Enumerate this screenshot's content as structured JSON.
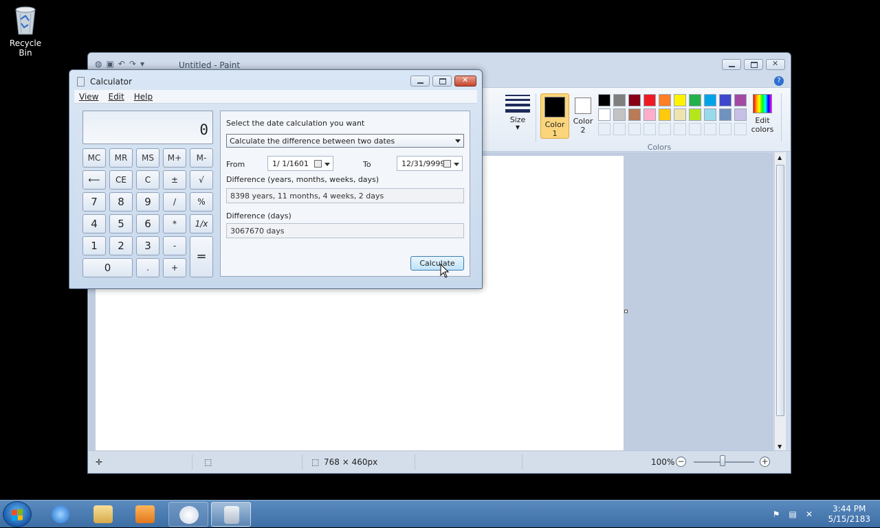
{
  "desktop": {
    "recycle_bin_label": "Recycle Bin"
  },
  "paint": {
    "title": "Untitled - Paint",
    "ribbon": {
      "size_label": "Size",
      "color1_label": "Color 1",
      "color2_label": "Color 2",
      "edit_colors_label": "Edit colors",
      "colors_group_label": "Colors",
      "color1_value": "#000000",
      "color2_value": "#ffffff",
      "palette_row1": [
        "#000000",
        "#7f7f7f",
        "#880015",
        "#ed1c24",
        "#ff7f27",
        "#fff200",
        "#22b14c",
        "#00a2e8",
        "#3f48cc",
        "#a349a4"
      ],
      "palette_row2": [
        "#ffffff",
        "#c3c3c3",
        "#b97a57",
        "#ffaec9",
        "#ffc90e",
        "#efe4b0",
        "#b5e61d",
        "#99d9ea",
        "#7092be",
        "#c8bfe7"
      ]
    },
    "status": {
      "canvas_size": "768 × 460px",
      "zoom": "100%"
    }
  },
  "calculator": {
    "title": "Calculator",
    "menu": [
      "View",
      "Edit",
      "Help"
    ],
    "display": "0",
    "keys": {
      "mc": "MC",
      "mr": "MR",
      "ms": "MS",
      "mplus": "M+",
      "mminus": "M-",
      "back": "⟵",
      "ce": "CE",
      "c": "C",
      "plusminus": "±",
      "sqrt": "√",
      "k7": "7",
      "k8": "8",
      "k9": "9",
      "div": "/",
      "pct": "%",
      "k4": "4",
      "k5": "5",
      "k6": "6",
      "mul": "*",
      "recip": "1/x",
      "k1": "1",
      "k2": "2",
      "k3": "3",
      "sub": "-",
      "eq": "=",
      "k0": "0",
      "dot": ".",
      "add": "+"
    },
    "date_panel": {
      "prompt": "Select the date calculation you want",
      "mode_selected": "Calculate the difference between two dates",
      "from_label": "From",
      "from_value": "1/ 1/1601",
      "to_label": "To",
      "to_value": "12/31/9999",
      "diff_ymwd_label": "Difference (years, months, weeks, days)",
      "diff_ymwd_value": "8398 years, 11 months, 4 weeks, 2 days",
      "diff_days_label": "Difference (days)",
      "diff_days_value": "3067670 days",
      "calculate_label": "Calculate"
    }
  },
  "taskbar": {
    "time": "3:44 PM",
    "date": "5/15/2183"
  }
}
